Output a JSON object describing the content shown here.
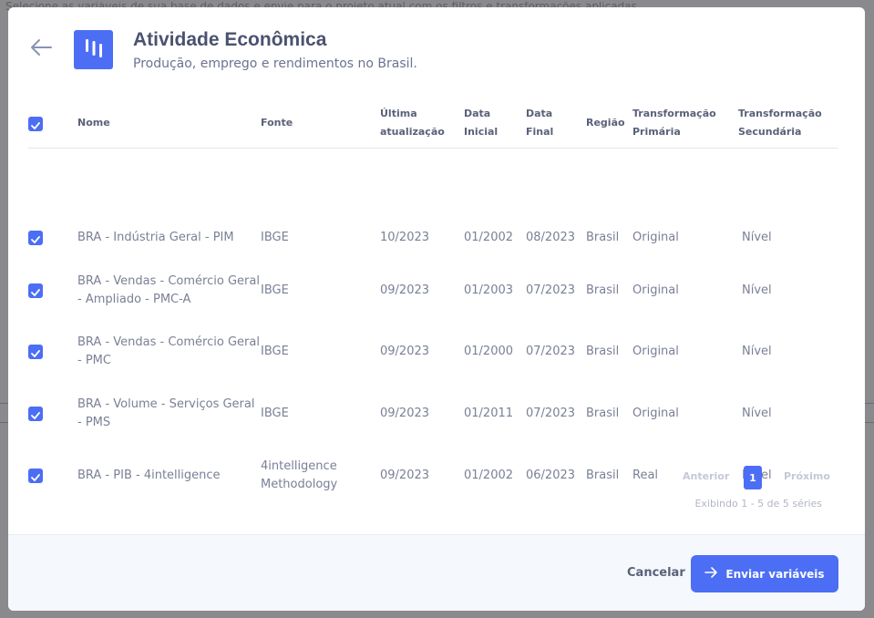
{
  "backdrop": {
    "text": "Selecione as variáveis de sua base de dados e envie para o projeto atual com os filtros e transformações aplicadas"
  },
  "modal": {
    "title": "Atividade Econômica",
    "subtitle": "Produção, emprego e rendimentos no Brasil."
  },
  "colors": {
    "accent": "#4c6ef5",
    "title": "#4b5270",
    "text": "#7a8096"
  },
  "table": {
    "headers": {
      "nome": "Nome",
      "fonte": "Fonte",
      "ultima_1": "Última",
      "ultima_2": "atualização",
      "inicial_1": "Data",
      "inicial_2": "Inicial",
      "final_1": "Data",
      "final_2": "Final",
      "regiao": "Região",
      "prim_1": "Transformação",
      "prim_2": "Primária",
      "sec_1": "Transformação",
      "sec_2": "Secundária"
    },
    "rows": [
      {
        "nome_1": "BRA - Indústria Geral - PIM",
        "nome_2": "",
        "fonte_1": "IBGE",
        "fonte_2": "",
        "ultima": "10/2023",
        "inicial": "01/2002",
        "final": "08/2023",
        "regiao": "Brasil",
        "primaria": "Original",
        "secundaria": "Nível",
        "checked": true
      },
      {
        "nome_1": "BRA - Vendas - Comércio Geral",
        "nome_2": "- Ampliado - PMC-A",
        "fonte_1": "IBGE",
        "fonte_2": "",
        "ultima": "09/2023",
        "inicial": "01/2003",
        "final": "07/2023",
        "regiao": "Brasil",
        "primaria": "Original",
        "secundaria": "Nível",
        "checked": true
      },
      {
        "nome_1": "BRA - Vendas - Comércio Geral",
        "nome_2": "- PMC",
        "fonte_1": "IBGE",
        "fonte_2": "",
        "ultima": "09/2023",
        "inicial": "01/2000",
        "final": "07/2023",
        "regiao": "Brasil",
        "primaria": "Original",
        "secundaria": "Nível",
        "checked": true
      },
      {
        "nome_1": "BRA - Volume - Serviços Geral",
        "nome_2": "- PMS",
        "fonte_1": "IBGE",
        "fonte_2": "",
        "ultima": "09/2023",
        "inicial": "01/2011",
        "final": "07/2023",
        "regiao": "Brasil",
        "primaria": "Original",
        "secundaria": "Nível",
        "checked": true
      },
      {
        "nome_1": "BRA - PIB - 4intelligence",
        "nome_2": "",
        "fonte_1": "4intelligence",
        "fonte_2": "Methodology",
        "ultima": "09/2023",
        "inicial": "01/2002",
        "final": "06/2023",
        "regiao": "Brasil",
        "primaria": "Real",
        "secundaria": "Nível",
        "checked": true
      }
    ]
  },
  "pagination": {
    "prev": "Anterior",
    "page": "1",
    "next": "Próximo",
    "showing": "Exibindo 1 - 5 de 5 séries"
  },
  "footer": {
    "cancel": "Cancelar",
    "send": "Enviar variáveis"
  },
  "icons": {
    "back": "arrow-left-icon",
    "logo": "bars-icon",
    "check": "check-icon",
    "send": "arrow-right-icon"
  }
}
